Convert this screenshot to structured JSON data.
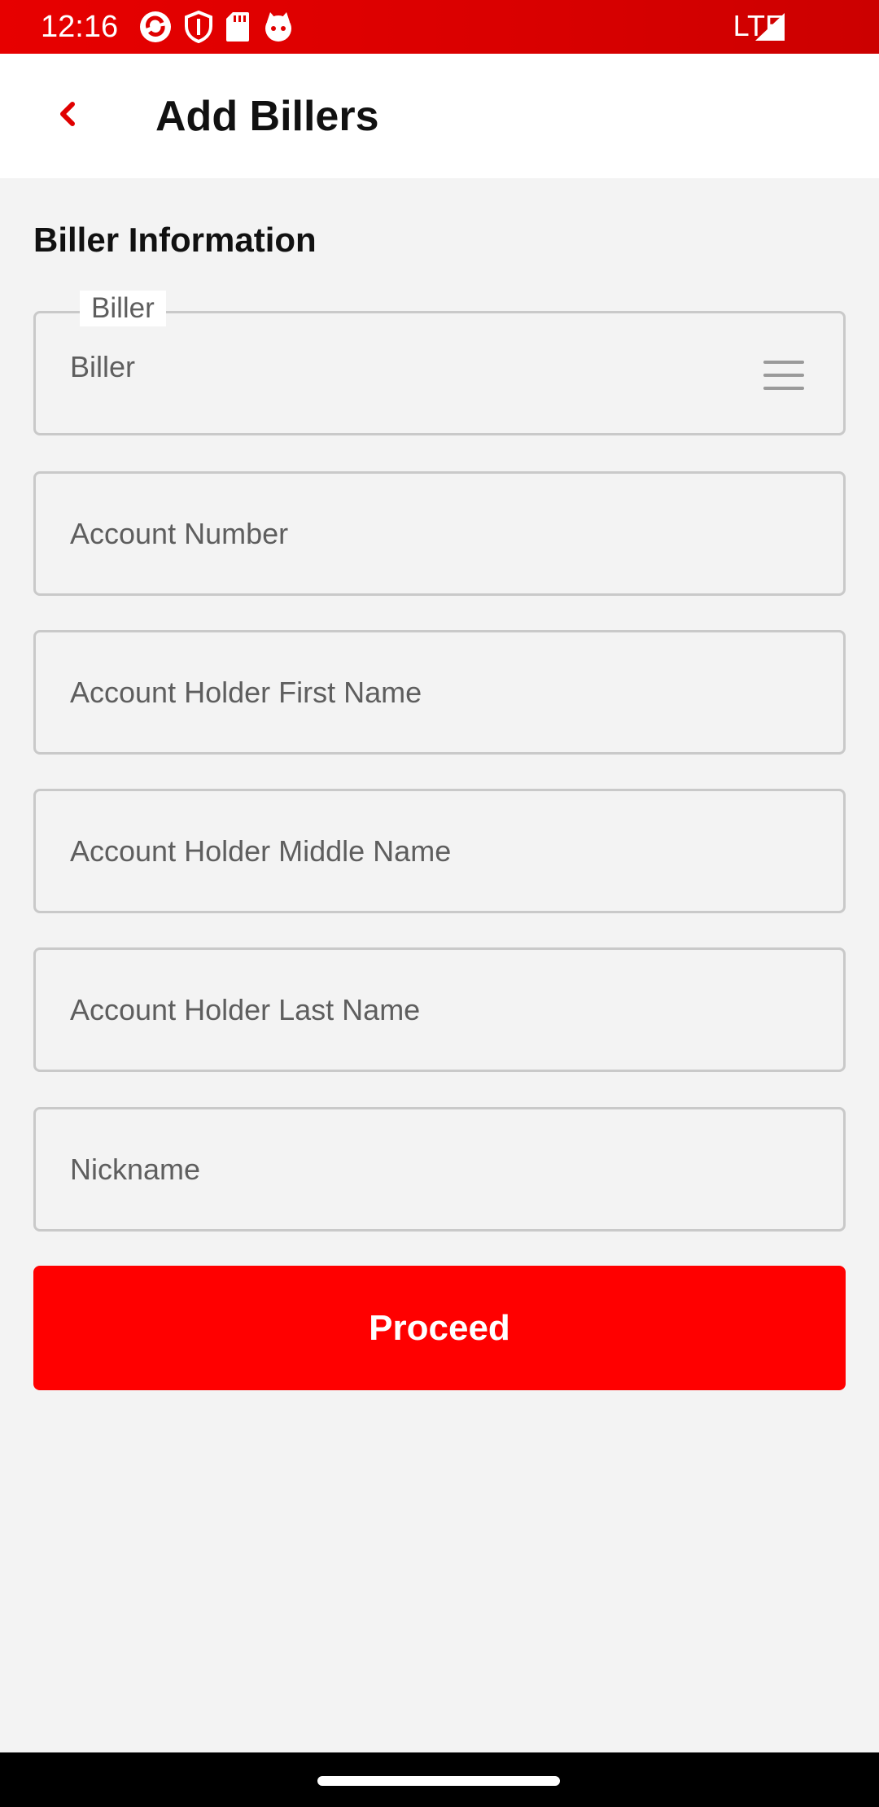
{
  "status_bar": {
    "time": "12:16",
    "network": "LTE",
    "icons": [
      "sync-icon",
      "shield-icon",
      "sd-card-icon",
      "cat-icon",
      "signal-icon"
    ],
    "background_color": "#e00000"
  },
  "app_bar": {
    "title": "Add Billers",
    "back_icon": "chevron-left-icon",
    "accent_color": "#e00000"
  },
  "form": {
    "section_title": "Biller Information",
    "biller": {
      "label": "Biller",
      "value": "Biller",
      "icon": "menu-icon"
    },
    "fields": [
      {
        "placeholder": "Account Number"
      },
      {
        "placeholder": "Account Holder First Name"
      },
      {
        "placeholder": "Account Holder Middle Name"
      },
      {
        "placeholder": "Account Holder Last Name"
      },
      {
        "placeholder": "Nickname"
      }
    ],
    "proceed_label": "Proceed",
    "proceed_color": "#ff0000"
  }
}
